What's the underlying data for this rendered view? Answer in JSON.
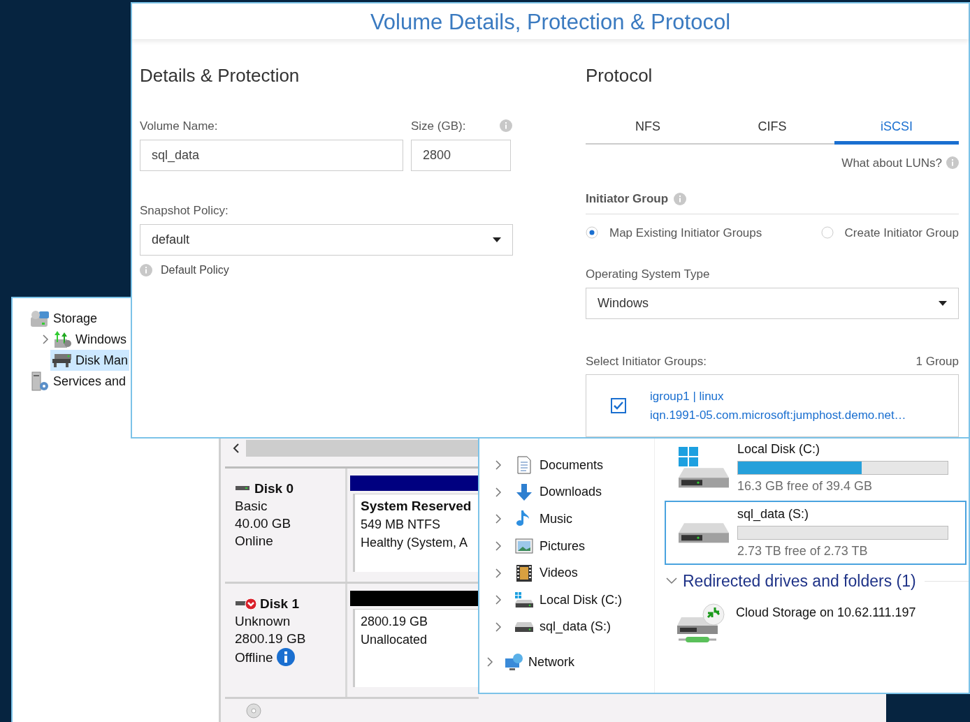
{
  "dialog": {
    "title": "Volume Details, Protection & Protocol",
    "details": {
      "heading": "Details & Protection",
      "volume_name": {
        "label": "Volume Name:",
        "value": "sql_data"
      },
      "size": {
        "label": "Size (GB):",
        "value": "2800"
      },
      "snapshot_policy": {
        "label": "Snapshot Policy:",
        "value": "default"
      },
      "policy_note": "Default Policy"
    },
    "protocol": {
      "heading": "Protocol",
      "tabs": [
        {
          "label": "NFS",
          "selected": false
        },
        {
          "label": "CIFS",
          "selected": false
        },
        {
          "label": "iSCSI",
          "selected": true
        }
      ],
      "luns_link": "What about LUNs?",
      "initiator_group": {
        "heading": "Initiator Group",
        "options": [
          {
            "label": "Map Existing Initiator Groups",
            "selected": true
          },
          {
            "label": "Create Initiator Group",
            "selected": false
          }
        ]
      },
      "os_type": {
        "label": "Operating System Type",
        "value": "Windows"
      },
      "select_groups": {
        "label": "Select Initiator Groups:",
        "count": "1 Group",
        "items": [
          {
            "name": "igroup1 | linux",
            "iqn": "iqn.1991-05.com.microsoft:jumphost.demo.net…",
            "checked": true
          }
        ]
      }
    }
  },
  "computer_management": {
    "tree": [
      {
        "label": "Storage",
        "kind": "storage",
        "expandable": false,
        "selected": false,
        "children": [
          {
            "label": "Windows",
            "kind": "backup",
            "expandable": true,
            "selected": false
          },
          {
            "label": "Disk Man",
            "kind": "disk",
            "expandable": false,
            "selected": true
          }
        ]
      },
      {
        "label": "Services and",
        "kind": "services",
        "expandable": false,
        "selected": false
      }
    ],
    "disks": [
      {
        "name": "Disk 0",
        "type": "Basic",
        "size": "40.00 GB",
        "status": "Online",
        "offline": false,
        "color": "#000080",
        "partition": {
          "title": "System Reserved",
          "lines": [
            "549 MB NTFS",
            "Healthy (System, A"
          ]
        }
      },
      {
        "name": "Disk 1",
        "type": "Unknown",
        "size": "2800.19 GB",
        "status": "Offline",
        "offline": true,
        "color": "#000000",
        "partition": {
          "lines": [
            "2800.19 GB",
            "Unallocated"
          ]
        }
      }
    ]
  },
  "explorer": {
    "this_pc_items": [
      {
        "label": "Documents",
        "kind": "documents"
      },
      {
        "label": "Downloads",
        "kind": "downloads"
      },
      {
        "label": "Music",
        "kind": "music"
      },
      {
        "label": "Pictures",
        "kind": "pictures"
      },
      {
        "label": "Videos",
        "kind": "videos"
      },
      {
        "label": "Local Disk (C:)",
        "kind": "system_drive"
      },
      {
        "label": "sql_data (S:)",
        "kind": "drive"
      }
    ],
    "network": {
      "label": "Network"
    },
    "drives": [
      {
        "name": "Local Disk (C:)",
        "free": "16.3 GB free of 39.4 GB",
        "level": 0.59,
        "kind": "system",
        "selected": false
      },
      {
        "name": "sql_data (S:)",
        "free": "2.73 TB free of 2.73 TB",
        "level": 0,
        "kind": "data",
        "selected": true
      }
    ],
    "redirected": {
      "heading": "Redirected drives and folders (1)",
      "expanded": true,
      "items": [
        {
          "label": "Cloud Storage on 10.62.111.197"
        }
      ]
    }
  }
}
